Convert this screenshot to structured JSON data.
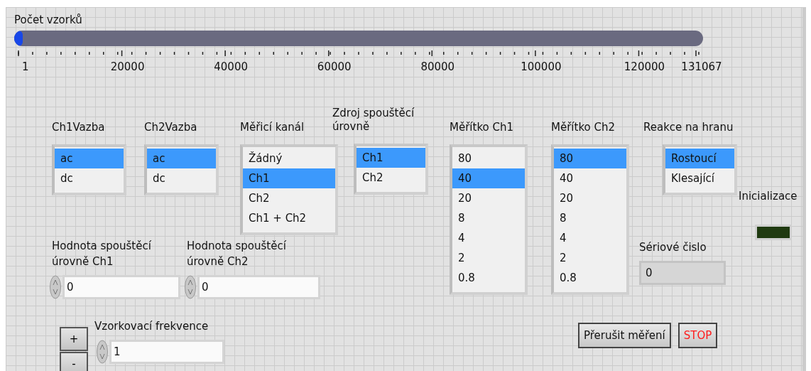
{
  "slider": {
    "label": "Počet vzorků",
    "level": 0,
    "ticks": [
      "1",
      "20000",
      "40000",
      "60000",
      "80000",
      "100000",
      "120000",
      "131067"
    ]
  },
  "listboxes": [
    {
      "label": "Ch1Vazba",
      "items": [
        {
          "text": "ac",
          "selected": true
        },
        {
          "text": "dc",
          "selected": false
        }
      ]
    },
    {
      "label": "Ch2Vazba",
      "items": [
        {
          "text": "ac",
          "selected": true
        },
        {
          "text": "dc",
          "selected": false
        }
      ]
    },
    {
      "label": "Měřicí kanál",
      "items": [
        {
          "text": "Žádný",
          "selected": false
        },
        {
          "text": "Ch1",
          "selected": true
        },
        {
          "text": "Ch2",
          "selected": false
        },
        {
          "text": "Ch1 + Ch2",
          "selected": false
        }
      ]
    },
    {
      "label": "Zdroj spouštěcí úrovně",
      "items": [
        {
          "text": "Ch1",
          "selected": true
        },
        {
          "text": "Ch2",
          "selected": false
        }
      ]
    },
    {
      "label": "Měřítko Ch1",
      "items": [
        {
          "text": "80",
          "selected": false
        },
        {
          "text": "40",
          "selected": true
        },
        {
          "text": "20",
          "selected": false
        },
        {
          "text": "8",
          "selected": false
        },
        {
          "text": "4",
          "selected": false
        },
        {
          "text": "2",
          "selected": false
        },
        {
          "text": "0.8",
          "selected": false
        }
      ]
    },
    {
      "label": "Měřítko Ch2",
      "items": [
        {
          "text": "80",
          "selected": true
        },
        {
          "text": "40",
          "selected": false
        },
        {
          "text": "20",
          "selected": false
        },
        {
          "text": "8",
          "selected": false
        },
        {
          "text": "4",
          "selected": false
        },
        {
          "text": "2",
          "selected": false
        },
        {
          "text": "0.8",
          "selected": false
        }
      ]
    },
    {
      "label": "Reakce na hranu",
      "items": [
        {
          "text": "Rostoucí",
          "selected": true
        },
        {
          "text": "Klesající",
          "selected": false
        }
      ]
    }
  ],
  "numerics": [
    {
      "label": "Hodnota spouštěcí úrovně Ch1",
      "value": "0"
    },
    {
      "label": "Hodnota spouštěcí úrovně Ch2",
      "value": "0"
    },
    {
      "label": "Vzorkovací frekvence",
      "value": "1"
    }
  ],
  "step_buttons": [
    "+",
    "-"
  ],
  "led": {
    "label": "Inicializace",
    "on": false
  },
  "serial": {
    "label": "Sériové čislo",
    "value": "0"
  },
  "buttons": [
    {
      "label": "Přerušit měření",
      "kind": "normal"
    },
    {
      "label": "STOP",
      "kind": "stop"
    }
  ]
}
